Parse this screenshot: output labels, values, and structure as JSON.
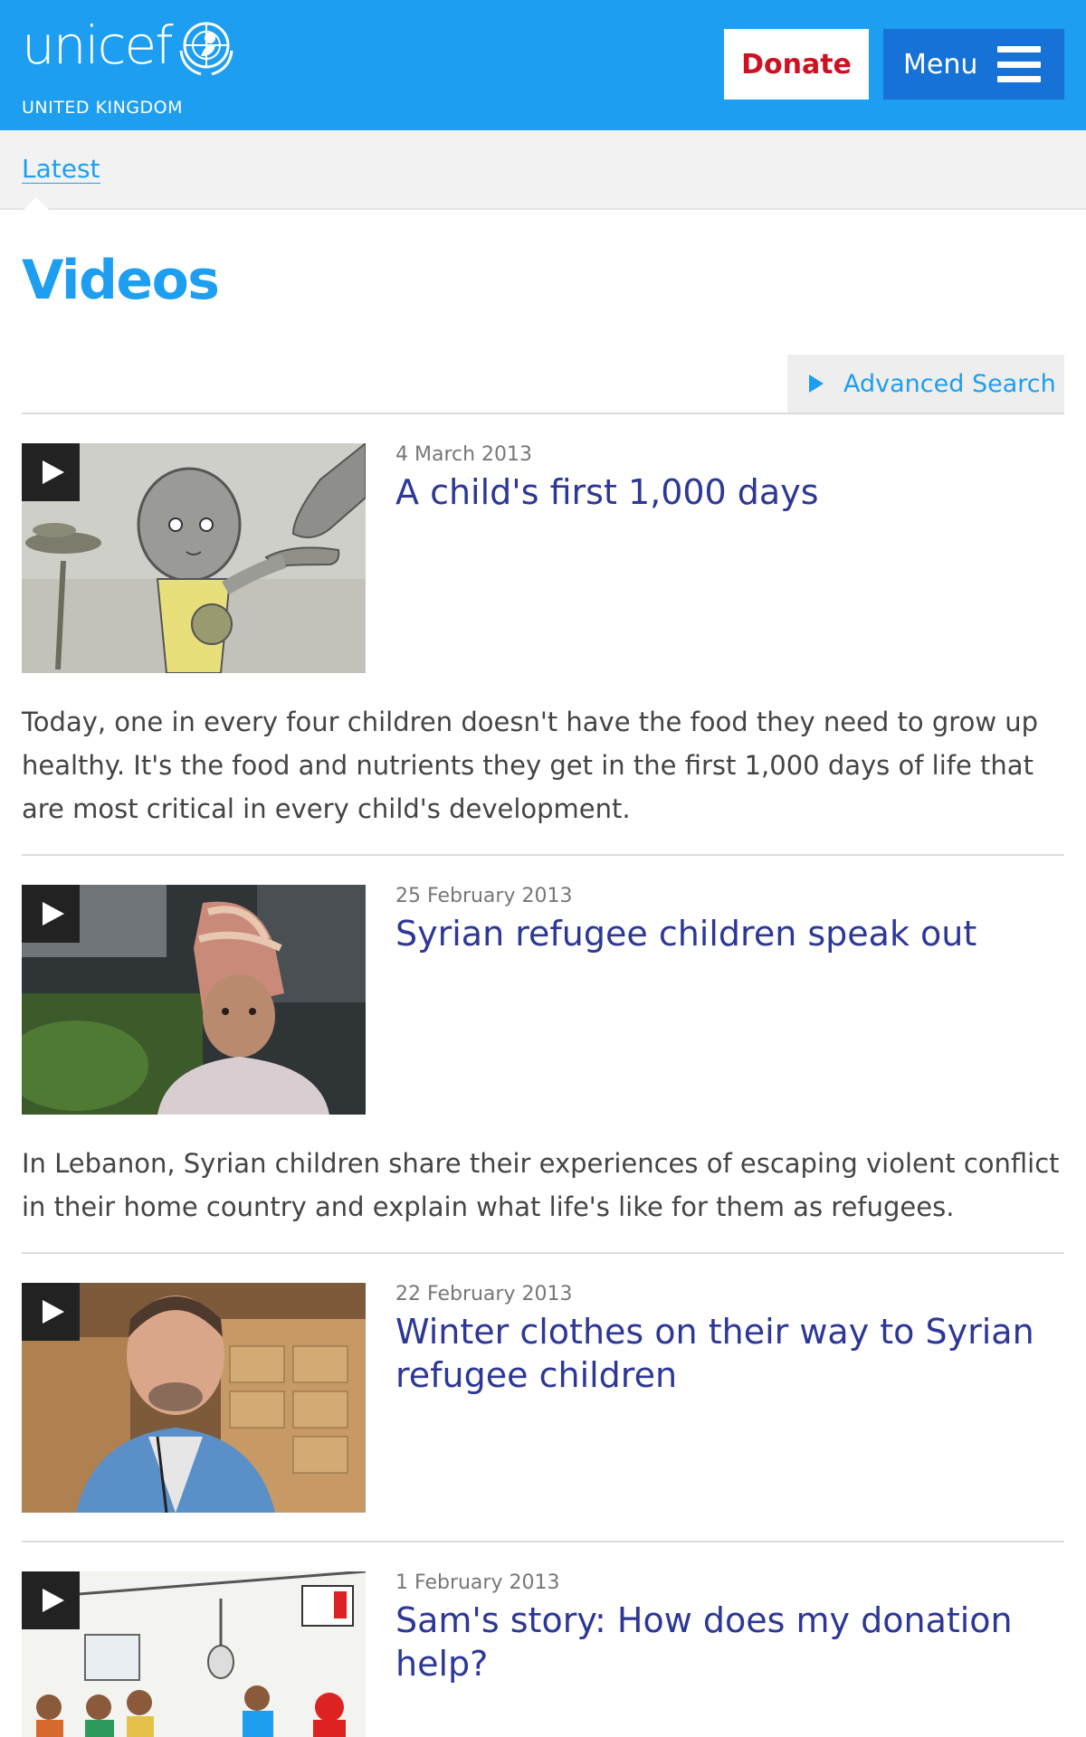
{
  "header": {
    "logo_text": "unicef",
    "logo_sub": "UNITED KINGDOM",
    "donate_label": "Donate",
    "menu_label": "Menu"
  },
  "breadcrumb": {
    "label": "Latest"
  },
  "page": {
    "title": "Videos"
  },
  "search": {
    "advanced_label": "Advanced Search"
  },
  "videos": [
    {
      "date": "4 March 2013",
      "title": "A child's first 1,000 days",
      "description": "Today, one in every four children doesn't have the food they need to grow up healthy. It's the food and nutrients they get in the first 1,000 days of life that are most critical in every child's development."
    },
    {
      "date": "25 February 2013",
      "title": "Syrian refugee children speak out",
      "description": "In Lebanon, Syrian children share their experiences of escaping violent conflict in their home country and explain what life's like for them as refugees."
    },
    {
      "date": "22 February 2013",
      "title": "Winter clothes on their way to Syrian refugee children",
      "description": ""
    },
    {
      "date": "1 February 2013",
      "title": "Sam's story: How does my donation help?",
      "description": ""
    }
  ],
  "icons": {
    "emblem": "unicef-emblem-icon",
    "menu": "hamburger-icon",
    "search_toggle": "triangle-right-icon",
    "play": "play-icon"
  },
  "colors": {
    "brand_blue": "#1e9ef0",
    "menu_blue": "#1672d6",
    "donate_red": "#cc1122",
    "title_link": "#2d3796"
  }
}
